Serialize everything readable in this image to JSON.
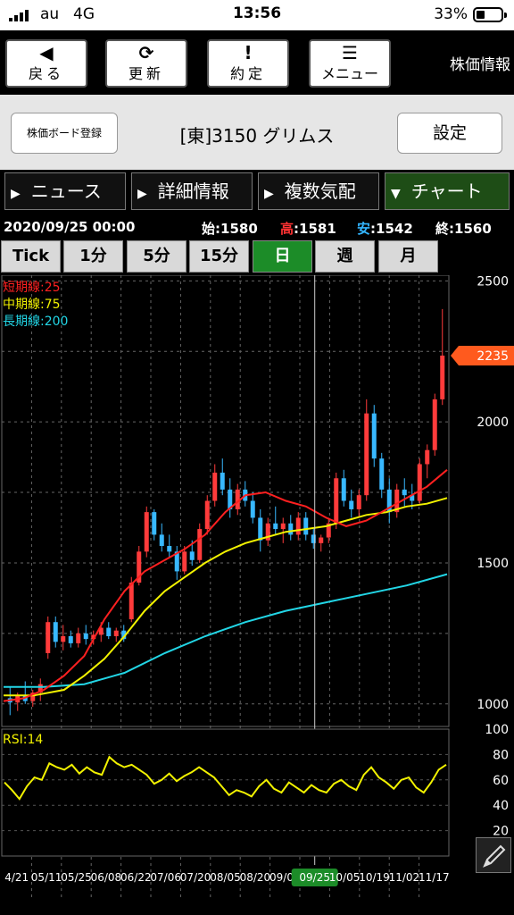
{
  "status_bar": {
    "carrier": "au",
    "network": "4G",
    "time": "13:56",
    "battery": "33%",
    "battery_level": 0.33
  },
  "toolbar": {
    "buttons": [
      {
        "icon": "back-arrow-icon",
        "label": "戻る"
      },
      {
        "icon": "refresh-icon",
        "label": "更新"
      },
      {
        "icon": "exclamation-icon",
        "label": "約定"
      },
      {
        "icon": "menu-list-icon",
        "label": "メニュー"
      }
    ],
    "app_title": "株価情報"
  },
  "stock_header": {
    "register_button": "株価ボード登録",
    "stock_name": "[東]3150 グリムス",
    "settings_button": "設定"
  },
  "tabs": [
    {
      "label": "ニュース",
      "active": false
    },
    {
      "label": "詳細情報",
      "active": false
    },
    {
      "label": "複数気配",
      "active": false
    },
    {
      "label": "チャート",
      "active": true
    }
  ],
  "ohlc": {
    "datetime": "2020/09/25 00:00",
    "open_label": "始",
    "open": "1580",
    "high_label": "高",
    "high": "1581",
    "low_label": "安",
    "low": "1542",
    "close_label": "終",
    "close": "1560"
  },
  "periods": [
    {
      "label": "Tick",
      "active": false
    },
    {
      "label": "1分",
      "active": false
    },
    {
      "label": "5分",
      "active": false
    },
    {
      "label": "15分",
      "active": false
    },
    {
      "label": "日",
      "active": true
    },
    {
      "label": "週",
      "active": false
    },
    {
      "label": "月",
      "active": false
    }
  ],
  "colors": {
    "ma_short": "#ff2020",
    "ma_mid": "#f2f200",
    "ma_long": "#22d6e6",
    "candle_up": "#ff3b3b",
    "candle_down": "#38b8ff",
    "current_price": "#ff5a1e",
    "active_green": "#1c8c28"
  },
  "chart_data": [
    {
      "type": "candlestick",
      "legend": [
        "短期線:25",
        "中期線:75",
        "長期線:200"
      ],
      "y_ticks": [
        "2500",
        "2000",
        "1500",
        "1000"
      ],
      "ylim": [
        920,
        2520
      ],
      "current_price_label": "2235",
      "current_price": 2235,
      "x_tick_labels": [
        "4/21",
        "05/11",
        "05/25",
        "06/08",
        "06/22",
        "07/06",
        "07/20",
        "08/05",
        "08/20",
        "09/03",
        "09/25",
        "10/05",
        "10/19",
        "11/02",
        "11/17"
      ],
      "selected_date": "09/25",
      "grid": true,
      "candles_sampled": [
        {
          "o": 1020,
          "h": 1060,
          "l": 960,
          "c": 1005
        },
        {
          "o": 1005,
          "h": 1040,
          "l": 975,
          "c": 1030
        },
        {
          "o": 1030,
          "h": 1080,
          "l": 1000,
          "c": 1010
        },
        {
          "o": 1010,
          "h": 1050,
          "l": 990,
          "c": 1040
        },
        {
          "o": 1040,
          "h": 1090,
          "l": 1010,
          "c": 1070
        },
        {
          "o": 1180,
          "h": 1310,
          "l": 1160,
          "c": 1290
        },
        {
          "o": 1290,
          "h": 1310,
          "l": 1200,
          "c": 1220
        },
        {
          "o": 1220,
          "h": 1280,
          "l": 1190,
          "c": 1240
        },
        {
          "o": 1240,
          "h": 1260,
          "l": 1200,
          "c": 1215
        },
        {
          "o": 1215,
          "h": 1270,
          "l": 1200,
          "c": 1250
        },
        {
          "o": 1250,
          "h": 1280,
          "l": 1210,
          "c": 1230
        },
        {
          "o": 1230,
          "h": 1260,
          "l": 1210,
          "c": 1245
        },
        {
          "o": 1245,
          "h": 1290,
          "l": 1220,
          "c": 1270
        },
        {
          "o": 1270,
          "h": 1290,
          "l": 1230,
          "c": 1240
        },
        {
          "o": 1240,
          "h": 1270,
          "l": 1220,
          "c": 1260
        },
        {
          "o": 1260,
          "h": 1280,
          "l": 1220,
          "c": 1230
        },
        {
          "o": 1300,
          "h": 1450,
          "l": 1290,
          "c": 1430
        },
        {
          "o": 1430,
          "h": 1560,
          "l": 1420,
          "c": 1540
        },
        {
          "o": 1540,
          "h": 1700,
          "l": 1520,
          "c": 1680
        },
        {
          "o": 1680,
          "h": 1690,
          "l": 1580,
          "c": 1600
        },
        {
          "o": 1600,
          "h": 1640,
          "l": 1540,
          "c": 1560
        },
        {
          "o": 1560,
          "h": 1600,
          "l": 1520,
          "c": 1540
        },
        {
          "o": 1540,
          "h": 1560,
          "l": 1440,
          "c": 1470
        },
        {
          "o": 1470,
          "h": 1560,
          "l": 1460,
          "c": 1540
        },
        {
          "o": 1540,
          "h": 1580,
          "l": 1490,
          "c": 1510
        },
        {
          "o": 1510,
          "h": 1640,
          "l": 1500,
          "c": 1620
        },
        {
          "o": 1620,
          "h": 1740,
          "l": 1600,
          "c": 1720
        },
        {
          "o": 1720,
          "h": 1850,
          "l": 1700,
          "c": 1820
        },
        {
          "o": 1820,
          "h": 1870,
          "l": 1740,
          "c": 1760
        },
        {
          "o": 1760,
          "h": 1800,
          "l": 1660,
          "c": 1690
        },
        {
          "o": 1690,
          "h": 1780,
          "l": 1670,
          "c": 1760
        },
        {
          "o": 1760,
          "h": 1790,
          "l": 1700,
          "c": 1720
        },
        {
          "o": 1720,
          "h": 1750,
          "l": 1640,
          "c": 1660
        },
        {
          "o": 1660,
          "h": 1690,
          "l": 1540,
          "c": 1580
        },
        {
          "o": 1580,
          "h": 1660,
          "l": 1560,
          "c": 1640
        },
        {
          "o": 1640,
          "h": 1700,
          "l": 1600,
          "c": 1620
        },
        {
          "o": 1620,
          "h": 1660,
          "l": 1570,
          "c": 1640
        },
        {
          "o": 1640,
          "h": 1670,
          "l": 1580,
          "c": 1600
        },
        {
          "o": 1600,
          "h": 1680,
          "l": 1580,
          "c": 1660
        },
        {
          "o": 1660,
          "h": 1680,
          "l": 1580,
          "c": 1600
        },
        {
          "o": 1600,
          "h": 1620,
          "l": 1550,
          "c": 1570
        },
        {
          "o": 1570,
          "h": 1600,
          "l": 1540,
          "c": 1590
        },
        {
          "o": 1590,
          "h": 1660,
          "l": 1570,
          "c": 1640
        },
        {
          "o": 1640,
          "h": 1820,
          "l": 1620,
          "c": 1800
        },
        {
          "o": 1800,
          "h": 1830,
          "l": 1700,
          "c": 1720
        },
        {
          "o": 1720,
          "h": 1760,
          "l": 1660,
          "c": 1690
        },
        {
          "o": 1690,
          "h": 1760,
          "l": 1660,
          "c": 1740
        },
        {
          "o": 1740,
          "h": 2080,
          "l": 1720,
          "c": 2030
        },
        {
          "o": 2030,
          "h": 2060,
          "l": 1840,
          "c": 1870
        },
        {
          "o": 1870,
          "h": 1890,
          "l": 1730,
          "c": 1760
        },
        {
          "o": 1760,
          "h": 1800,
          "l": 1640,
          "c": 1680
        },
        {
          "o": 1680,
          "h": 1780,
          "l": 1660,
          "c": 1760
        },
        {
          "o": 1760,
          "h": 1800,
          "l": 1700,
          "c": 1740
        },
        {
          "o": 1740,
          "h": 1780,
          "l": 1690,
          "c": 1720
        },
        {
          "o": 1720,
          "h": 1870,
          "l": 1710,
          "c": 1850
        },
        {
          "o": 1850,
          "h": 1920,
          "l": 1800,
          "c": 1900
        },
        {
          "o": 1900,
          "h": 2100,
          "l": 1880,
          "c": 2080
        },
        {
          "o": 2080,
          "h": 2400,
          "l": 2060,
          "c": 2235
        }
      ],
      "ma_short_points": [
        [
          0,
          1010
        ],
        [
          8,
          1020
        ],
        [
          16,
          1050
        ],
        [
          24,
          1100
        ],
        [
          32,
          1170
        ],
        [
          40,
          1300
        ],
        [
          48,
          1400
        ],
        [
          56,
          1470
        ],
        [
          64,
          1510
        ],
        [
          72,
          1550
        ],
        [
          80,
          1600
        ],
        [
          88,
          1680
        ],
        [
          96,
          1740
        ],
        [
          104,
          1750
        ],
        [
          112,
          1720
        ],
        [
          120,
          1700
        ],
        [
          128,
          1660
        ],
        [
          136,
          1630
        ],
        [
          144,
          1650
        ],
        [
          152,
          1690
        ],
        [
          160,
          1730
        ],
        [
          168,
          1770
        ],
        [
          176,
          1830
        ]
      ],
      "ma_mid_points": [
        [
          0,
          1030
        ],
        [
          12,
          1030
        ],
        [
          24,
          1050
        ],
        [
          32,
          1100
        ],
        [
          40,
          1160
        ],
        [
          48,
          1240
        ],
        [
          56,
          1330
        ],
        [
          64,
          1400
        ],
        [
          72,
          1450
        ],
        [
          80,
          1500
        ],
        [
          88,
          1540
        ],
        [
          96,
          1570
        ],
        [
          104,
          1590
        ],
        [
          112,
          1610
        ],
        [
          120,
          1620
        ],
        [
          128,
          1630
        ],
        [
          136,
          1650
        ],
        [
          144,
          1670
        ],
        [
          152,
          1680
        ],
        [
          160,
          1700
        ],
        [
          168,
          1710
        ],
        [
          176,
          1730
        ]
      ],
      "ma_long_points": [
        [
          0,
          1060
        ],
        [
          16,
          1060
        ],
        [
          32,
          1070
        ],
        [
          48,
          1110
        ],
        [
          64,
          1180
        ],
        [
          80,
          1240
        ],
        [
          96,
          1290
        ],
        [
          112,
          1330
        ],
        [
          128,
          1360
        ],
        [
          144,
          1390
        ],
        [
          160,
          1420
        ],
        [
          176,
          1460
        ]
      ]
    },
    {
      "type": "line",
      "legend": [
        "RSI:14"
      ],
      "y_ticks": [
        "100",
        "80",
        "60",
        "40",
        "20"
      ],
      "ylim": [
        0,
        100
      ],
      "values": [
        58,
        52,
        45,
        55,
        62,
        60,
        73,
        70,
        68,
        72,
        65,
        70,
        66,
        64,
        78,
        73,
        70,
        72,
        68,
        64,
        57,
        60,
        65,
        59,
        63,
        66,
        70,
        66,
        62,
        55,
        48,
        52,
        50,
        47,
        55,
        60,
        53,
        50,
        58,
        54,
        50,
        56,
        52,
        50,
        57,
        60,
        55,
        52,
        64,
        70,
        62,
        58,
        53,
        60,
        62,
        54,
        50,
        58,
        68,
        72
      ]
    }
  ]
}
